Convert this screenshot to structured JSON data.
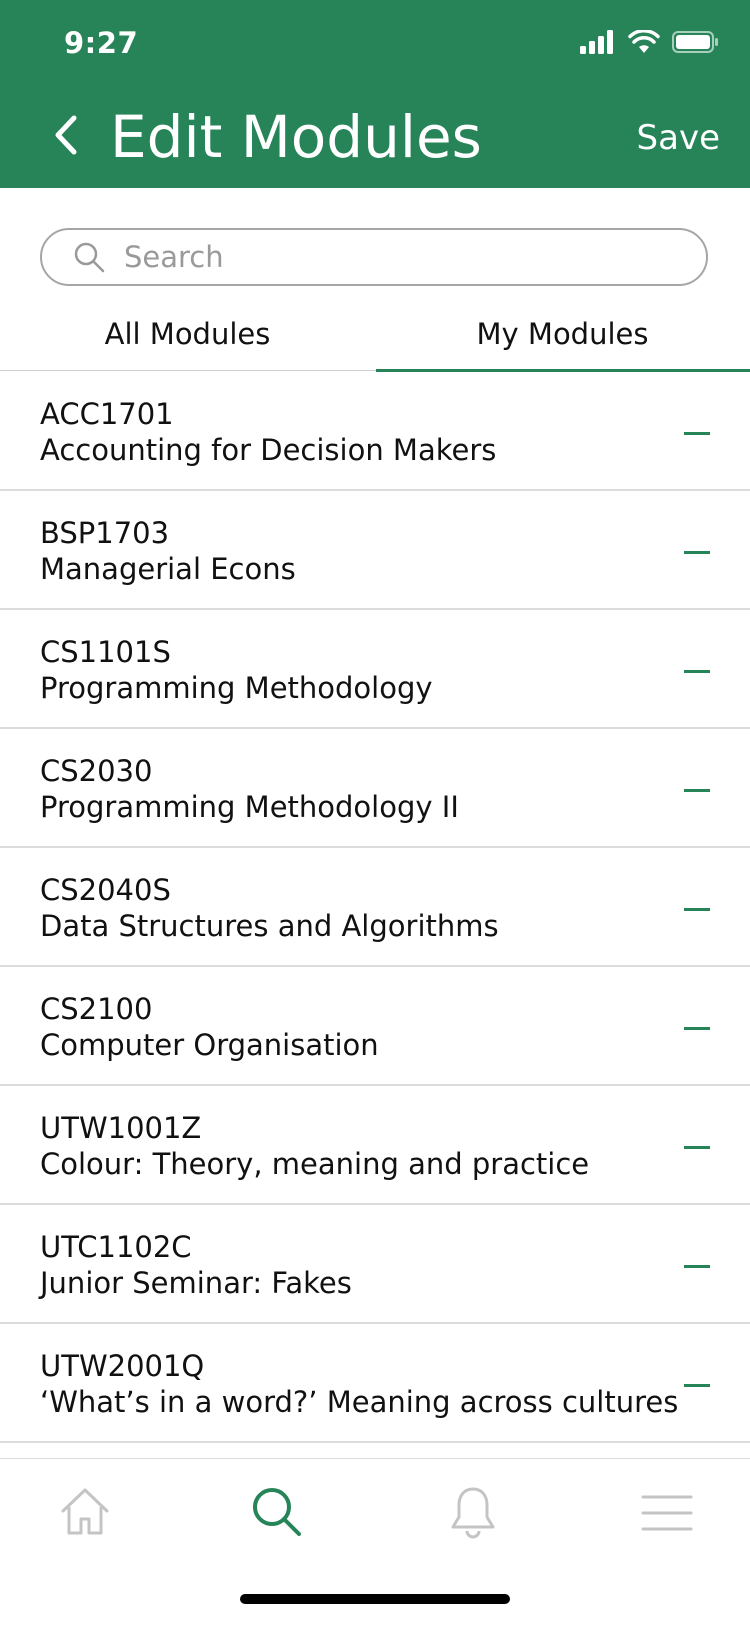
{
  "status_bar": {
    "time": "9:27"
  },
  "header": {
    "title": "Edit Modules",
    "save_label": "Save",
    "background": "#268458"
  },
  "search": {
    "placeholder": "Search",
    "value": ""
  },
  "tabs": [
    {
      "label": "All Modules",
      "active": false
    },
    {
      "label": "My Modules",
      "active": true
    }
  ],
  "modules": [
    {
      "code": "ACC1701",
      "name": "Accounting for Decision Makers"
    },
    {
      "code": "BSP1703",
      "name": "Managerial Econs"
    },
    {
      "code": "CS1101S",
      "name": "Programming Methodology"
    },
    {
      "code": "CS2030",
      "name": "Programming Methodology II"
    },
    {
      "code": "CS2040S",
      "name": "Data Structures and Algorithms"
    },
    {
      "code": "CS2100",
      "name": "Computer Organisation"
    },
    {
      "code": "UTW1001Z",
      "name": "Colour: Theory, meaning and practice"
    },
    {
      "code": "UTC1102C",
      "name": "Junior Seminar: Fakes"
    },
    {
      "code": "UTW2001Q",
      "name": "‘What’s in a word?’ Meaning across cultures"
    }
  ],
  "tabbar": {
    "items": [
      {
        "icon": "home-icon",
        "active": false
      },
      {
        "icon": "search-icon",
        "active": true
      },
      {
        "icon": "bell-icon",
        "active": false
      },
      {
        "icon": "menu-icon",
        "active": false
      }
    ]
  },
  "colors": {
    "accent": "#268458",
    "inactive_icon": "#c4c4c4"
  }
}
